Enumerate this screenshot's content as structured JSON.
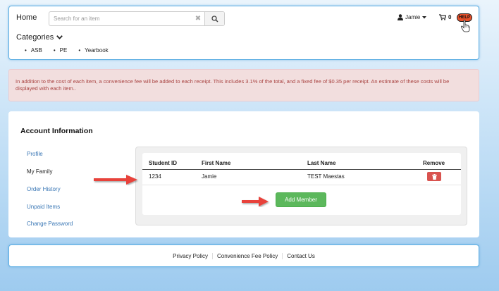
{
  "header": {
    "home": "Home",
    "search": {
      "placeholder": "Search for an item",
      "value": ""
    },
    "user": "Jamie",
    "cart_count": "0",
    "help": "HELP",
    "categories_label": "Categories",
    "categories": [
      "ASB",
      "PE",
      "Yearbook"
    ]
  },
  "alert": {
    "text": "In addition to the cost of each item, a convenience fee will be added to each receipt. This includes 3.1% of the total, and a fixed fee of $0.35 per receipt. An estimate of these costs will be displayed with each item.."
  },
  "account": {
    "title": "Account Information",
    "menu": [
      "Profile",
      "My Family",
      "Order History",
      "Unpaid Items",
      "Change Password"
    ],
    "table": {
      "headers": [
        "Student ID",
        "First Name",
        "Last Name",
        "Remove"
      ],
      "rows": [
        {
          "student_id": "1234",
          "first_name": "Jamie",
          "last_name": "TEST Maestas"
        }
      ]
    },
    "add_member": "Add Member"
  },
  "footer": {
    "links": [
      "Privacy Policy",
      "Convenience Fee Policy",
      "Contact Us"
    ]
  },
  "colors": {
    "accent_border": "#5fb0e4",
    "alert_bg": "#f2dede",
    "alert_text": "#a94442",
    "danger": "#d9534f",
    "success": "#5cb85c",
    "link": "#3a77b5",
    "annotation_arrow": "#e8433b"
  },
  "icons": [
    "search-icon",
    "clear-icon",
    "user-icon",
    "caret-down-icon",
    "cart-icon",
    "chevron-down-icon",
    "hand-pointer-icon",
    "trash-icon",
    "arrow-right-icon"
  ]
}
